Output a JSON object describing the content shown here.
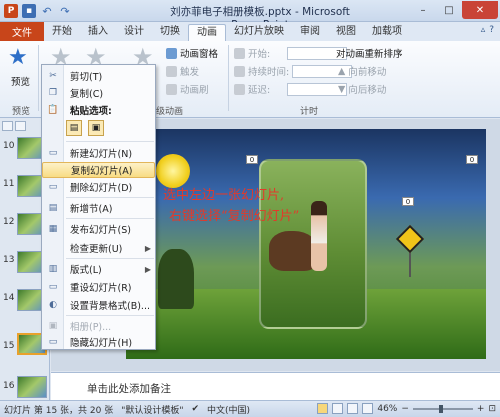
{
  "window": {
    "title": "刘亦菲电子相册模板.pptx - Microsoft PowerPoint",
    "app_logo": "P",
    "controls": [
      "–",
      "□",
      "✕"
    ]
  },
  "tabs": {
    "file": "文件",
    "items": [
      "开始",
      "插入",
      "设计",
      "切换",
      "动画",
      "幻灯片放映",
      "审阅",
      "视图",
      "加载项"
    ],
    "active": "动画"
  },
  "ribbon": {
    "preview_label": "预览",
    "preview_group": "预览",
    "animation_pane": "动画窗格",
    "trigger": "触发",
    "animation_painter": "动画刷",
    "advanced_group": "高级动画",
    "start_label": "开始:",
    "duration_label": "持续时间:",
    "delay_label": "延迟:",
    "timing_group": "计时",
    "reorder_title": "对动画重新排序",
    "move_earlier": "向前移动",
    "move_later": "向后移动"
  },
  "context_menu": {
    "items": [
      {
        "label": "剪切(T)",
        "icon": "cut-icon"
      },
      {
        "label": "复制(C)",
        "icon": "copy-icon"
      },
      {
        "label": "粘贴选项:",
        "icon": "paste-icon"
      },
      {
        "label": "新建幻灯片(N)",
        "icon": "new-slide-icon"
      },
      {
        "label": "复制幻灯片(A)",
        "icon": "duplicate-slide-icon"
      },
      {
        "label": "删除幻灯片(D)",
        "icon": "delete-slide-icon"
      },
      {
        "label": "新增节(A)",
        "icon": "add-section-icon"
      },
      {
        "label": "发布幻灯片(S)",
        "icon": "publish-icon"
      },
      {
        "label": "检查更新(U)",
        "icon": "check-update-icon"
      },
      {
        "label": "版式(L)",
        "icon": "layout-icon"
      },
      {
        "label": "重设幻灯片(R)",
        "icon": "reset-icon"
      },
      {
        "label": "设置背景格式(B)...",
        "icon": "format-background-icon"
      },
      {
        "label": "相册(P)...",
        "icon": "photo-album-icon"
      },
      {
        "label": "隐藏幻灯片(H)",
        "icon": "hide-slide-icon"
      }
    ],
    "highlighted": "复制幻灯片(A)"
  },
  "slide_pane": {
    "numbers": [
      "10",
      "11",
      "12",
      "13",
      "14",
      "15",
      "16"
    ]
  },
  "slide": {
    "overlay_line1": "选中左边一张幻灯片,",
    "overlay_line2": "右键选择“复制幻灯片”",
    "anim_tag": "0"
  },
  "notes": {
    "placeholder": "单击此处添加备注"
  },
  "statusbar": {
    "slide_info": "幻灯片 第 15 张，共 20 张",
    "theme": "\"默认设计模板\"",
    "language": "中文(中国)",
    "zoom": "46%"
  },
  "watermark": "Bai 经验"
}
